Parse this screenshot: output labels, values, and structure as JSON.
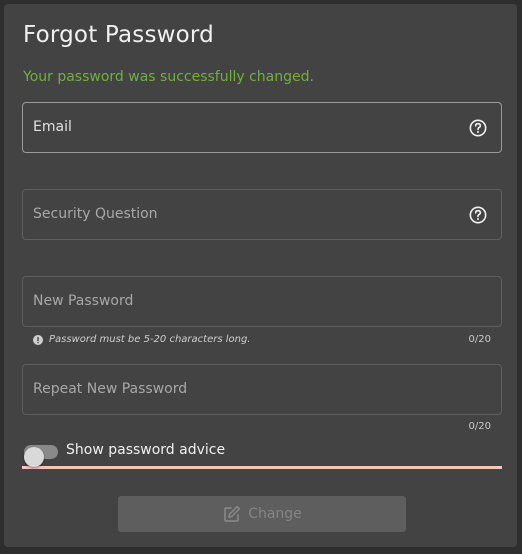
{
  "page": {
    "title": "Forgot Password",
    "success_message": "Your password was successfully changed."
  },
  "fields": {
    "email": {
      "label": "Email"
    },
    "security_question": {
      "label": "Security Question"
    },
    "new_password": {
      "label": "New Password",
      "hint": "Password must be 5-20 characters long.",
      "counter": "0/20"
    },
    "repeat_password": {
      "label": "Repeat New Password",
      "counter": "0/20"
    }
  },
  "toggle": {
    "label": "Show password advice",
    "checked": false
  },
  "button": {
    "label": "Change",
    "icon": "edit-icon",
    "disabled": true
  },
  "colors": {
    "success": "#6fb13d",
    "card_background": "#434343",
    "highlight_underline": "#f4c6b9"
  }
}
